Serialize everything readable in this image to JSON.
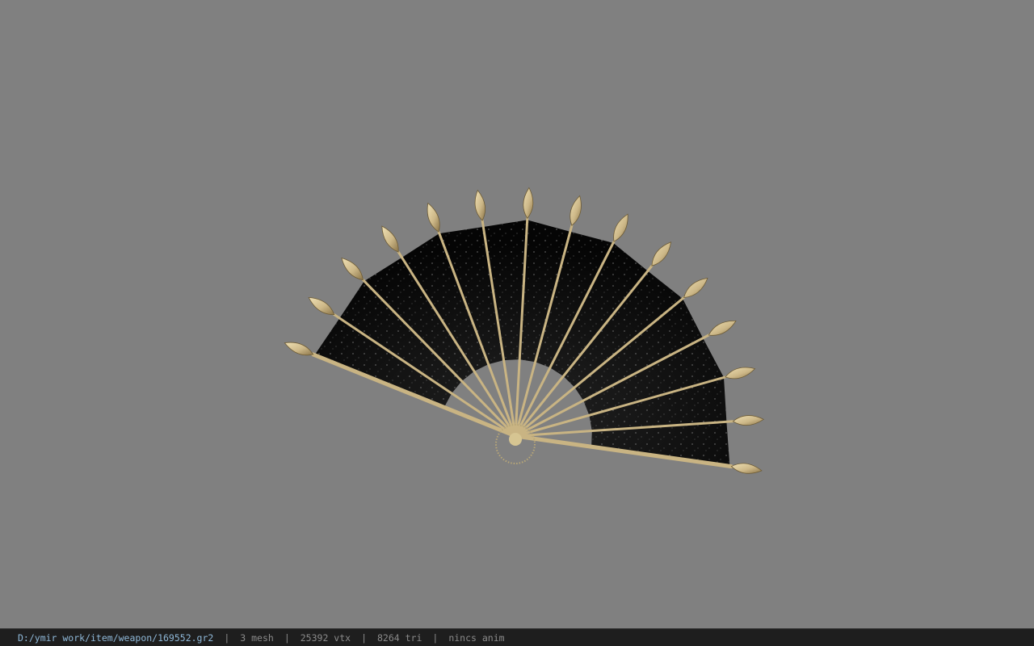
{
  "viewer": {
    "background_color": "#808080",
    "model": {
      "description": "folding fan weapon",
      "paper_color": "#0b0b0b",
      "rib_color": "#c9b483",
      "tip_color": "#d8c79a",
      "rib_count": 15
    }
  },
  "status_bar": {
    "file_path": "D:/ymir work/item/weapon/169552.gr2",
    "mesh_count": "3 mesh",
    "vertex_count": "25392 vtx",
    "triangle_count": "8264 tri",
    "anim_status": "nincs anim",
    "separator": "|"
  }
}
